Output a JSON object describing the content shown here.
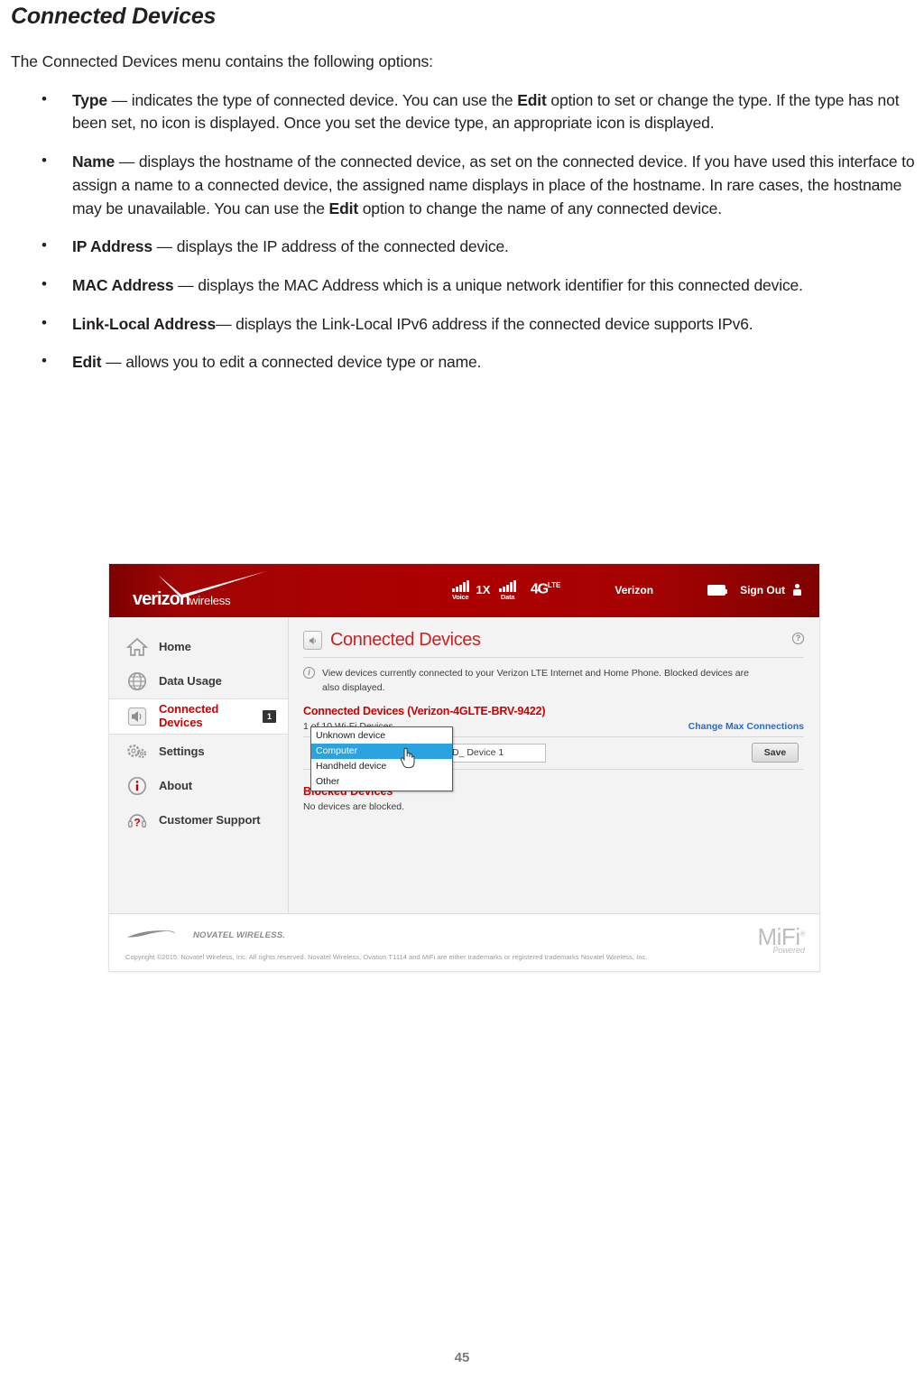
{
  "document": {
    "title": "Connected Devices",
    "intro": "The Connected Devices menu contains the following options:",
    "bullets": [
      {
        "term": "Type",
        "text": " — indicates the type of connected device. You can use the ",
        "term2": "Edit",
        "text2": " option to set or change the type. If the type has not been set, no icon is displayed. Once you set the device type, an appropriate icon is displayed."
      },
      {
        "term": "Name",
        "text": " — displays the hostname of the connected device, as set on the connected device. If you have used this interface to assign a name to a connected device, the assigned name displays in place of the hostname. In rare cases, the hostname may be unavailable. You can use the ",
        "term2": "Edit",
        "text2": " option to change the name of any connected device."
      },
      {
        "term": "IP Address",
        "text": " — displays the IP address of the connected device.",
        "term2": "",
        "text2": ""
      },
      {
        "term": "MAC Address",
        "text": " — displays the MAC Address which is a unique network identifier for this connected device.",
        "term2": "",
        "text2": ""
      },
      {
        "term": "Link-Local Address",
        "text": "— displays the Link-Local IPv6 address if the connected device supports IPv6.",
        "term2": "",
        "text2": ""
      },
      {
        "term": "Edit",
        "text": " — allows you to edit a connected device type or name.",
        "term2": "",
        "text2": ""
      }
    ],
    "page_number": "45"
  },
  "screenshot": {
    "header": {
      "logo_brand": "verizon",
      "logo_sub": "wireless",
      "voice_label": "Voice",
      "network_1x": "1X",
      "data_label": "Data",
      "network_4g": "4G",
      "network_4g_sup": "LTE",
      "carrier": "Verizon",
      "sign_out": "Sign Out"
    },
    "sidebar": {
      "items": [
        {
          "label": "Home",
          "icon": "home-icon",
          "badge": "",
          "active": false
        },
        {
          "label": "Data Usage",
          "icon": "globe-icon",
          "badge": "",
          "active": false
        },
        {
          "label": "Connected Devices",
          "icon": "speaker-icon",
          "badge": "1",
          "active": true
        },
        {
          "label": "Settings",
          "icon": "gears-icon",
          "badge": "",
          "active": false
        },
        {
          "label": "About",
          "icon": "info-icon",
          "badge": "",
          "active": false
        },
        {
          "label": "Customer Support",
          "icon": "headset-question-icon",
          "badge": "",
          "active": false
        }
      ]
    },
    "main": {
      "panel_title": "Connected Devices",
      "help_glyph": "?",
      "info_glyph": "i",
      "info_text": "View devices currently connected to your Verizon LTE Internet and Home Phone. Blocked devices are also displayed.",
      "section_title": "Connected Devices (Verizon-4GLTE-BRV-9422)",
      "device_count_text": "1 of 10 Wi-Fi Devices.",
      "change_max_link": "Change Max Connections",
      "device_name_value": "SD_ Device 1",
      "save_label": "Save",
      "dropdown_options": [
        {
          "label": "Unknown device",
          "selected": false
        },
        {
          "label": "Computer",
          "selected": true
        },
        {
          "label": "Handheld device",
          "selected": false
        },
        {
          "label": "Other",
          "selected": false
        }
      ],
      "blocked_title": "Blocked Devices",
      "blocked_text": "No devices are blocked."
    },
    "footer": {
      "brand": "NOVATEL WIRELESS.",
      "copyright": "Copyright ©2015. Novatel Wireless, Inc. All rights reserved. Novatel Wireless, Ovation T1114 and MiFi are either trademarks or registered trademarks Novatel Wireless, Inc.",
      "mifi": "MiFi",
      "mifi_sup": "®",
      "mifi_sub": "Powered"
    },
    "colors": {
      "verizon_red": "#AD0000",
      "accent_red": "#CC0000",
      "link_blue": "#1D6FD6",
      "select_blue": "#2AA3E0",
      "panel_bg": "#F3F3F3"
    }
  }
}
